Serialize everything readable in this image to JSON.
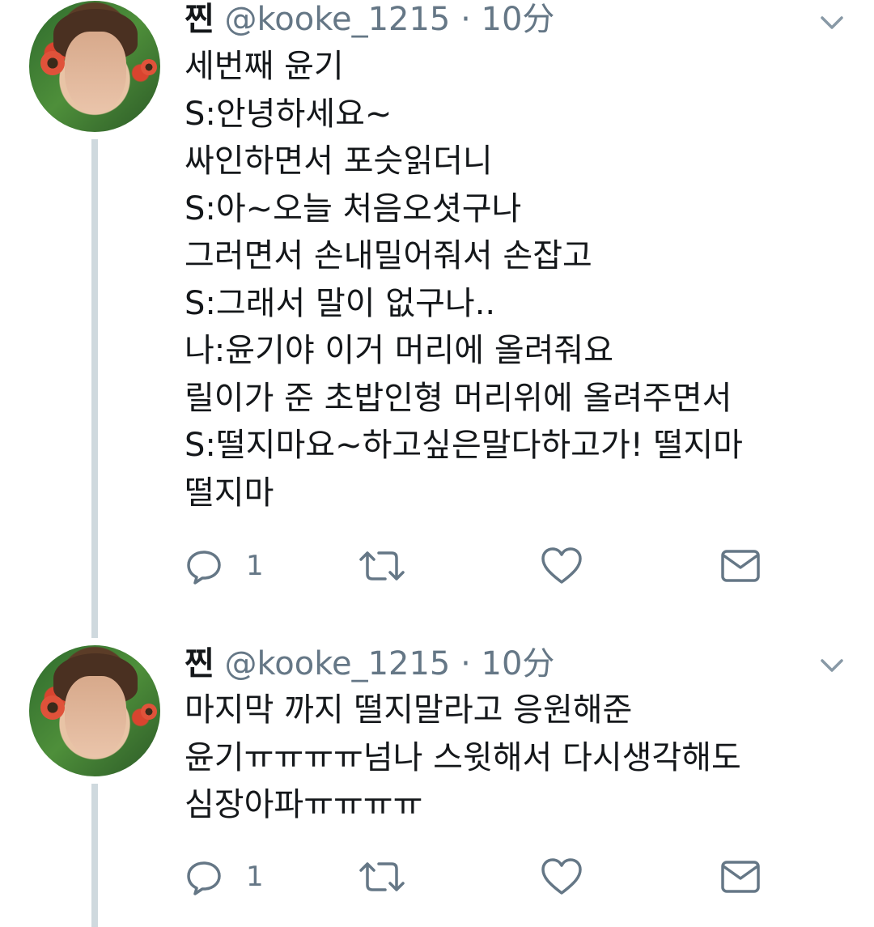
{
  "tweets": [
    {
      "author_name": "찐",
      "handle": "@kooke_1215",
      "separator": "·",
      "time": "10分",
      "lines": [
        "세번째 윤기",
        "S:안녕하세요~",
        "싸인하면서 포슷읽더니",
        "S:아~오늘 처음오셧구나",
        "그러면서 손내밀어줘서 손잡고",
        "S:그래서 말이 없구나..",
        "나:윤기야 이거 머리에 올려줘요",
        "릴이가 준 초밥인형 머리위에 올려주면서",
        "S:떨지마요~하고싶은말다하고가! 떨지마",
        "떨지마"
      ],
      "reply_count": "1",
      "icons": [
        "reply-icon",
        "retweet-icon",
        "like-icon",
        "direct-message-icon",
        "chevron-down-icon"
      ]
    },
    {
      "author_name": "찐",
      "handle": "@kooke_1215",
      "separator": "·",
      "time": "10分",
      "lines": [
        "마지막 까지 떨지말라고 응원해준",
        "윤기ㅠㅠㅠㅠ넘나 스윗해서 다시생각해도",
        "심장아파ㅠㅠㅠㅠ"
      ],
      "reply_count": "1",
      "icons": [
        "reply-icon",
        "retweet-icon",
        "like-icon",
        "direct-message-icon",
        "chevron-down-icon"
      ]
    }
  ],
  "colors": {
    "text": "#14171a",
    "secondary": "#657786",
    "thread_line": "#cfd9de",
    "background": "#ffffff"
  }
}
